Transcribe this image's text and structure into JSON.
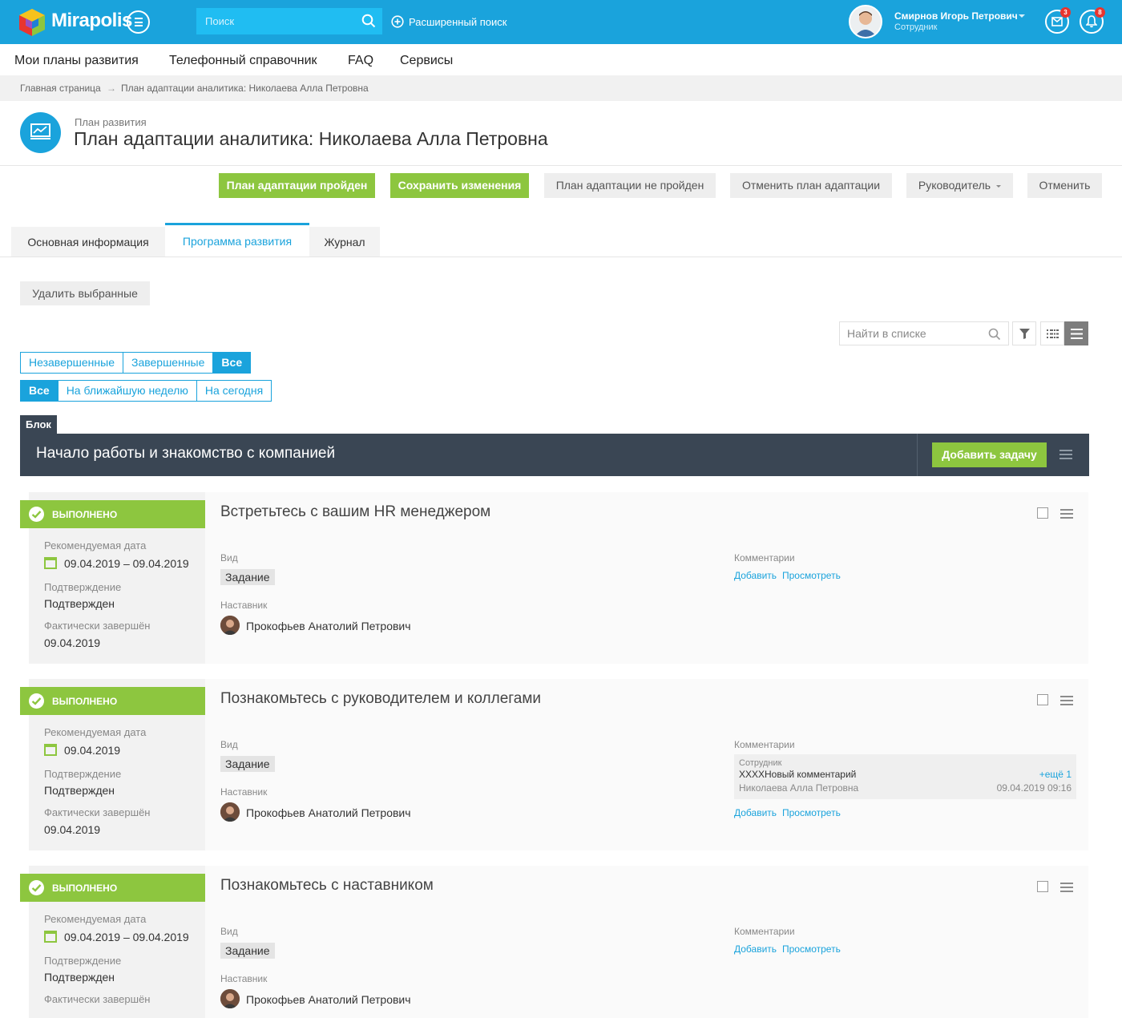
{
  "header": {
    "logo_text": "Mirapolis",
    "search_placeholder": "Поиск",
    "advanced_search": "Расширенный поиск",
    "user_name": "Смирнов Игорь Петрович",
    "user_role": "Сотрудник",
    "messages_badge": "3",
    "notifications_badge": "8",
    "accent_color": "#1aa3dc"
  },
  "nav": {
    "items": [
      "Мои планы развития",
      "Телефонный справочник",
      "FAQ",
      "Сервисы"
    ]
  },
  "breadcrumbs": {
    "home": "Главная страница",
    "separator": "→",
    "current": "План адаптации аналитика: Николаева Алла Петровна"
  },
  "page": {
    "subtitle": "План развития",
    "title": "План адаптации аналитика: Николаева Алла Петровна"
  },
  "actions": {
    "passed": "План адаптации пройден",
    "save": "Сохранить изменения",
    "not_passed": "План адаптации не пройден",
    "cancel_plan": "Отменить план адаптации",
    "manager": "Руководитель",
    "cancel": "Отменить"
  },
  "tabs": [
    "Основная информация",
    "Программа развития",
    "Журнал"
  ],
  "toolbar": {
    "delete_selected": "Удалить выбранные",
    "list_search_placeholder": "Найти в списке"
  },
  "filters": {
    "status": [
      "Незавершенные",
      "Завершенные",
      "Все"
    ],
    "period": [
      "Все",
      "На ближайшую неделю",
      "На сегодня"
    ]
  },
  "block": {
    "tag": "Блок",
    "title": "Начало работы и знакомство с компанией",
    "add_task": "Добавить задачу"
  },
  "labels": {
    "status_done": "ВЫПОЛНЕНО",
    "recommended_date": "Рекомендуемая дата",
    "confirmation": "Подтверждение",
    "actual_finish": "Фактически завершён",
    "kind": "Вид",
    "mentor": "Наставник",
    "comments": "Комментарии",
    "add": "Добавить",
    "view": "Просмотреть"
  },
  "tasks": [
    {
      "title": "Встретьтесь с вашим HR менеджером",
      "date": "09.04.2019 – 09.04.2019",
      "confirmation": "Подтвержден",
      "finished": "09.04.2019",
      "kind": "Задание",
      "mentor": "Прокофьев Анатолий Петрович"
    },
    {
      "title": "Познакомьтесь с руководителем и коллегами",
      "date": "09.04.2019",
      "confirmation": "Подтвержден",
      "finished": "09.04.2019",
      "kind": "Задание",
      "mentor": "Прокофьев Анатолий Петрович",
      "comment": {
        "role": "Сотрудник",
        "text": "XXXXНовый комментарий",
        "more": "+ещё 1",
        "author": "Николаева Алла Петровна",
        "datetime": "09.04.2019 09:16"
      }
    },
    {
      "title": "Познакомьтесь с наставником",
      "date": "09.04.2019 – 09.04.2019",
      "confirmation": "Подтвержден",
      "finished": "",
      "kind": "Задание",
      "mentor": "Прокофьев Анатолий Петрович"
    }
  ]
}
